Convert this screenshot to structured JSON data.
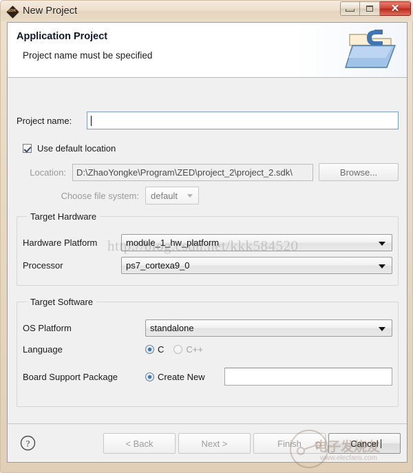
{
  "window": {
    "title": "New Project",
    "app_icon": "sdk-diamond-icon",
    "icon_label": "SDK",
    "controls": {
      "minimize": "minimize-button",
      "maximize": "maximize-button",
      "close": "close-button",
      "close_glyph": "✕"
    }
  },
  "header": {
    "title": "Application Project",
    "subtitle": "Project name must be specified",
    "icon": "c-folder-icon"
  },
  "form": {
    "project_name_label": "Project name:",
    "project_name_value": "",
    "use_default_location_label": "Use default location",
    "use_default_location_checked": true,
    "location_label": "Location:",
    "location_value": "D:\\ZhaoYongke\\Program\\ZED\\project_2\\project_2.sdk\\",
    "browse_label": "Browse...",
    "file_system_label": "Choose file system:",
    "file_system_value": "default"
  },
  "target_hardware": {
    "group_title": "Target Hardware",
    "hardware_platform_label": "Hardware Platform",
    "hardware_platform_value": "module_1_hw_platform",
    "processor_label": "Processor",
    "processor_value": "ps7_cortexa9_0"
  },
  "target_software": {
    "group_title": "Target Software",
    "os_platform_label": "OS Platform",
    "os_platform_value": "standalone",
    "language_label": "Language",
    "language_options": [
      {
        "label": "C",
        "selected": true
      },
      {
        "label": "C++",
        "selected": false
      }
    ],
    "bsp_label": "Board Support Package",
    "bsp_option_label": "Create New",
    "bsp_option_selected": true,
    "bsp_value": ""
  },
  "buttons": {
    "help": "help-button",
    "back": "< Back",
    "next": "Next >",
    "finish": "Finish",
    "cancel": "Cancel"
  },
  "watermarks": {
    "csdn": "http://blog.csdn.net/kkk584520",
    "elecfans_cn": "电子发烧友",
    "elecfans_url": "www.elecfans.com"
  },
  "colors": {
    "titlebar": "#ecdcc8",
    "close_red": "#c93a28",
    "accent_blue": "#2e7bb5",
    "focus_border": "#7ba1c4",
    "dialog_bg": "#f0f0f0"
  }
}
